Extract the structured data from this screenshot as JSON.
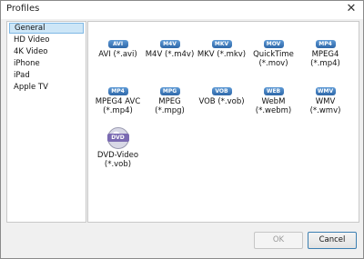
{
  "window": {
    "title": "Profiles",
    "close_glyph": "✕"
  },
  "sidebar": {
    "items": [
      {
        "label": "General",
        "selected": true
      },
      {
        "label": "HD Video"
      },
      {
        "label": "4K Video"
      },
      {
        "label": "iPhone"
      },
      {
        "label": "iPad"
      },
      {
        "label": "Apple TV"
      }
    ]
  },
  "profiles": [
    {
      "badge": "AVI",
      "label": "AVI (*.avi)"
    },
    {
      "badge": "M4V",
      "label": "M4V (*.m4v)"
    },
    {
      "badge": "MKV",
      "label": "MKV (*.mkv)"
    },
    {
      "badge": "MOV",
      "label": "QuickTime\n(*.mov)"
    },
    {
      "badge": "MP4",
      "label": "MPEG4\n(*.mp4)"
    },
    {
      "badge": "MP4",
      "label": "MPEG4 AVC\n(*.mp4)"
    },
    {
      "badge": "MPG",
      "label": "MPEG\n(*.mpg)"
    },
    {
      "badge": "VOB",
      "label": "VOB (*.vob)"
    },
    {
      "badge": "WEB",
      "label": "WebM\n(*.webm)"
    },
    {
      "badge": "WMV",
      "label": "WMV\n(*.wmv)"
    },
    {
      "badge": "DVD",
      "label": "DVD-Video\n(*.vob)",
      "icon": "disc-icon"
    }
  ],
  "buttons": {
    "ok": "OK",
    "cancel": "Cancel"
  }
}
